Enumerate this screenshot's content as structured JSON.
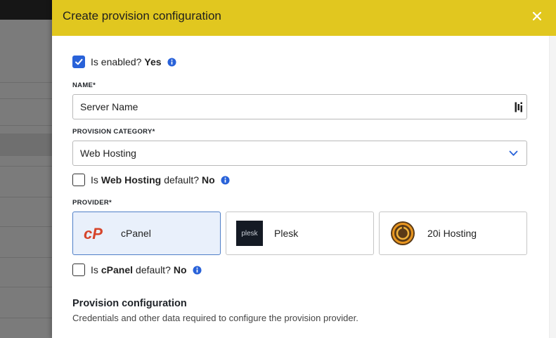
{
  "dialog": {
    "title": "Create provision configuration",
    "close_icon": "close-icon"
  },
  "enabled": {
    "label": "Is enabled?",
    "value": "Yes",
    "checked": true
  },
  "name_field": {
    "label": "NAME*",
    "value": "Server Name"
  },
  "category_field": {
    "label": "PROVISION CATEGORY*",
    "value": "Web Hosting"
  },
  "category_default": {
    "prefix": "Is",
    "category": "Web Hosting",
    "suffix": "default?",
    "value": "No",
    "checked": false
  },
  "provider_field": {
    "label": "PROVIDER*",
    "options": [
      {
        "name": "cPanel",
        "logo_text": "cP",
        "selected": true
      },
      {
        "name": "Plesk",
        "logo_text": "plesk",
        "selected": false
      },
      {
        "name": "20i Hosting",
        "logo_text": "",
        "selected": false
      }
    ]
  },
  "provider_default": {
    "prefix": "Is",
    "provider": "cPanel",
    "suffix": "default?",
    "value": "No",
    "checked": false
  },
  "section": {
    "title": "Provision configuration",
    "description": "Credentials and other data required to configure the provision provider."
  },
  "colors": {
    "header": "#e1c71f",
    "accent": "#2962d9",
    "cpanel": "#d6452b",
    "selected_card_bg": "#e9f0fb"
  }
}
